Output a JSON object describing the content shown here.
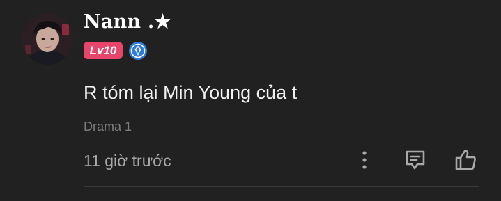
{
  "comment": {
    "username": "Nann .★",
    "level_badge": "Lv10",
    "text": "R tóm lại Min Young của t",
    "tag": "Drama 1",
    "time": "11 giờ trước",
    "colors": {
      "background": "#212121",
      "badge": "#e8456b",
      "verify_icon": "#2f7bd9",
      "text": "#f2f2f2",
      "muted": "#7d7d7d"
    },
    "icons": {
      "verify": "verified-badge-icon",
      "more": "more-vertical-icon",
      "reply": "comment-reply-icon",
      "like": "thumbs-up-icon"
    }
  }
}
